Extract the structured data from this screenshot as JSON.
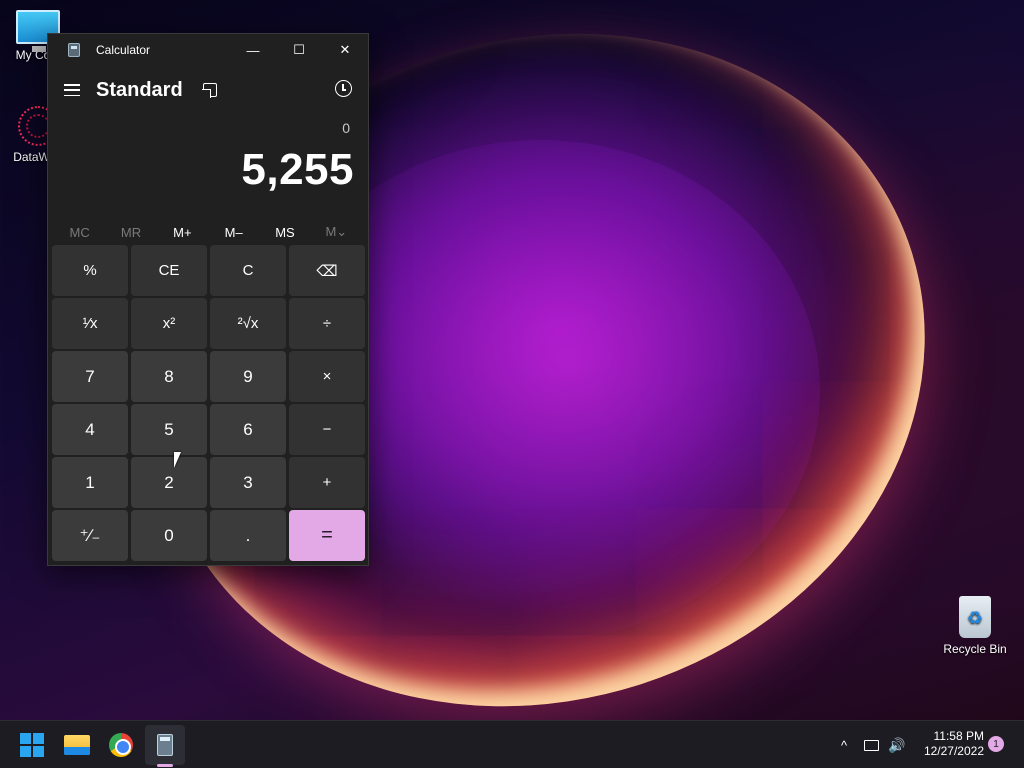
{
  "desktop": {
    "icons": [
      {
        "label": "My Com"
      },
      {
        "label": "DataWag"
      },
      {
        "label": "Recycle Bin"
      }
    ]
  },
  "calculator": {
    "window_title": "Calculator",
    "window_controls": {
      "minimize": "—",
      "maximize": "☐",
      "close": "✕"
    },
    "mode": "Standard",
    "expression": "0",
    "display": "5,255",
    "memory": [
      {
        "label": "MC",
        "enabled": false
      },
      {
        "label": "MR",
        "enabled": false
      },
      {
        "label": "M+",
        "enabled": true
      },
      {
        "label": "M–",
        "enabled": true
      },
      {
        "label": "MS",
        "enabled": true
      },
      {
        "label": "M⌄",
        "enabled": false
      }
    ],
    "keys": [
      {
        "label": "%",
        "kind": "fn",
        "name": "percent-button"
      },
      {
        "label": "CE",
        "kind": "fn",
        "name": "clear-entry-button"
      },
      {
        "label": "C",
        "kind": "fn",
        "name": "clear-button"
      },
      {
        "label": "⌫",
        "kind": "fn",
        "name": "backspace-button"
      },
      {
        "label": "¹⁄x",
        "kind": "fn",
        "name": "reciprocal-button"
      },
      {
        "label": "x²",
        "kind": "fn",
        "name": "square-button"
      },
      {
        "label": "²√x",
        "kind": "fn",
        "name": "square-root-button"
      },
      {
        "label": "÷",
        "kind": "fn",
        "name": "divide-button"
      },
      {
        "label": "7",
        "kind": "num",
        "name": "digit-7-button"
      },
      {
        "label": "8",
        "kind": "num",
        "name": "digit-8-button"
      },
      {
        "label": "9",
        "kind": "num",
        "name": "digit-9-button"
      },
      {
        "label": "×",
        "kind": "fn",
        "name": "multiply-button"
      },
      {
        "label": "4",
        "kind": "num",
        "name": "digit-4-button"
      },
      {
        "label": "5",
        "kind": "num",
        "name": "digit-5-button"
      },
      {
        "label": "6",
        "kind": "num",
        "name": "digit-6-button"
      },
      {
        "label": "−",
        "kind": "fn",
        "name": "subtract-button"
      },
      {
        "label": "1",
        "kind": "num",
        "name": "digit-1-button"
      },
      {
        "label": "2",
        "kind": "num",
        "name": "digit-2-button"
      },
      {
        "label": "3",
        "kind": "num",
        "name": "digit-3-button"
      },
      {
        "label": "+",
        "kind": "fn",
        "name": "add-button"
      },
      {
        "label": "⁺∕₋",
        "kind": "num",
        "name": "negate-button"
      },
      {
        "label": "0",
        "kind": "num",
        "name": "digit-0-button"
      },
      {
        "label": ".",
        "kind": "num",
        "name": "decimal-button"
      },
      {
        "label": "=",
        "kind": "eq",
        "name": "equals-button"
      }
    ],
    "accent_color": "#e3a8e6"
  },
  "taskbar": {
    "pinned": [
      "start-icon",
      "file-explorer-icon",
      "chrome-icon",
      "calculator-icon"
    ],
    "tray_chevron": "^",
    "volume_glyph": "🔊",
    "time": "11:58 PM",
    "date": "12/27/2022",
    "notification_count": "1"
  }
}
